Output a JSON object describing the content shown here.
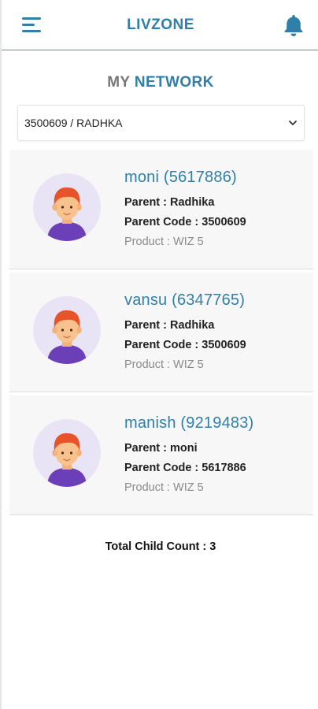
{
  "header": {
    "title": "LIVZONE",
    "menu_icon": "menu-icon",
    "notification_icon": "bell-icon",
    "accent": "#2f7fa8"
  },
  "network": {
    "title_prefix": "MY",
    "title_highlight": "NETWORK",
    "selected": "3500609 / RADHKA"
  },
  "children": [
    {
      "name": "moni (5617886)",
      "parent": "Parent : Radhika",
      "parent_code": "Parent Code : 3500609",
      "product": "Product : WIZ 5"
    },
    {
      "name": "vansu (6347765)",
      "parent": "Parent : Radhika",
      "parent_code": "Parent Code : 3500609",
      "product": "Product : WIZ 5"
    },
    {
      "name": "manish (9219483)",
      "parent": "Parent : moni",
      "parent_code": "Parent Code : 5617886",
      "product": "Product : WIZ 5"
    }
  ],
  "footer": {
    "total": "Total Child Count : 3"
  }
}
